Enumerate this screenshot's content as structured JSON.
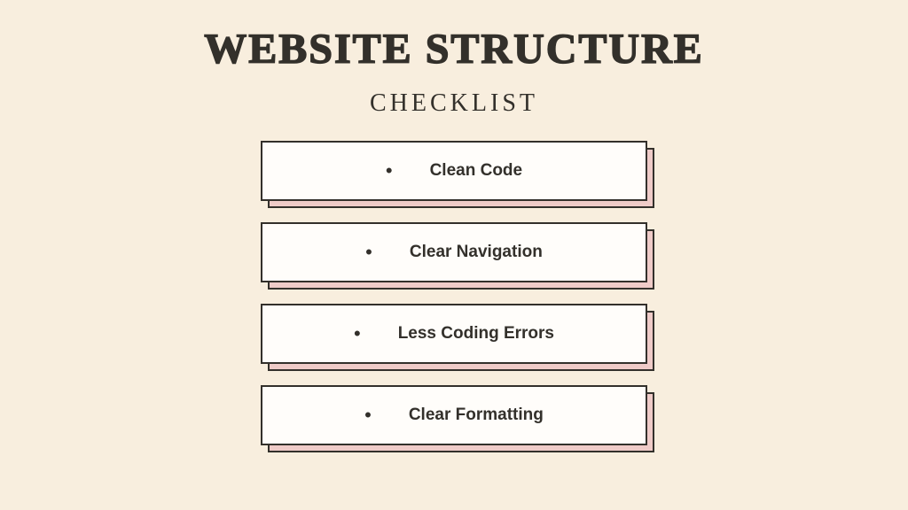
{
  "title": "WEBSITE STRUCTURE",
  "subtitle": "CHECKLIST",
  "items": [
    {
      "text": "Clean Code"
    },
    {
      "text": "Clear Navigation"
    },
    {
      "text": "Less Coding Errors"
    },
    {
      "text": "Clear Formatting"
    }
  ]
}
